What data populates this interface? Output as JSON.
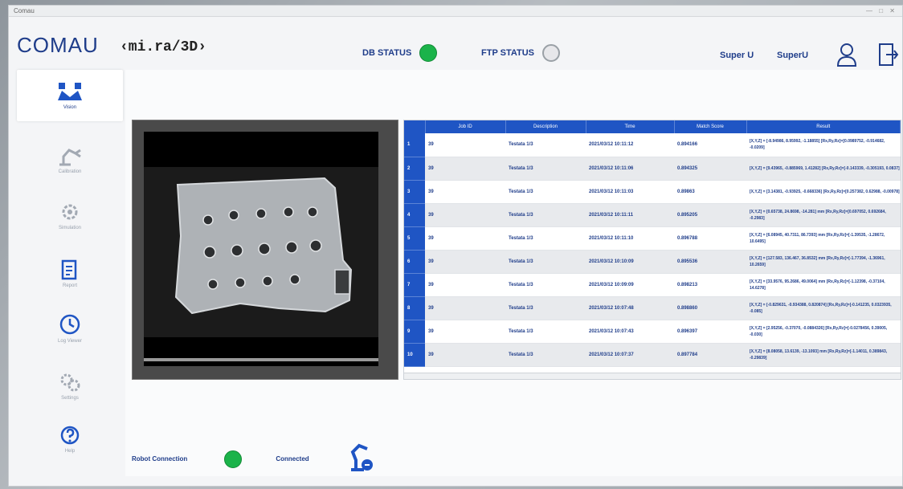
{
  "window": {
    "title": "Comau"
  },
  "header": {
    "logo": "COMAU",
    "product": "‹mi.ra/3D›",
    "db_status_label": "DB STATUS",
    "ftp_status_label": "FTP STATUS",
    "user_role": "Super U",
    "user_name": "SuperU"
  },
  "sidebar": {
    "items": [
      {
        "label": "Vision",
        "icon": "vision-icon"
      },
      {
        "label": "Calibration",
        "icon": "robot-arm-icon"
      },
      {
        "label": "Simulation",
        "icon": "gear-icon"
      },
      {
        "label": "Report",
        "icon": "report-icon"
      },
      {
        "label": "Log Viewer",
        "icon": "history-icon"
      },
      {
        "label": "Settings",
        "icon": "settings-icon"
      },
      {
        "label": "Help",
        "icon": "help-icon"
      }
    ]
  },
  "table": {
    "columns": [
      "Job ID",
      "Description",
      "Time",
      "Match Score",
      "Result"
    ],
    "rows": [
      {
        "n": "1",
        "job": "39",
        "desc": "Testata 1/3",
        "time": "2021/03/12 10:11:12",
        "score": "0.894166",
        "result": "[X,Y,Z] = [-8.94986, 8.95992, -1.18855] [Rx,Ry,Rz]=[0.0989752, -0.914682, -0.0209]"
      },
      {
        "n": "2",
        "job": "39",
        "desc": "Testata 1/3",
        "time": "2021/03/12 10:11:06",
        "score": "0.894325",
        "result": "[X,Y,Z] = [9.43965, -0.885969, 1.41282] [Rx,Ry,Rz]=[-0.143339, -0.305193, 0.0837]"
      },
      {
        "n": "3",
        "job": "39",
        "desc": "Testata 1/3",
        "time": "2021/03/12 10:11:03",
        "score": "0.89863",
        "result": "[X,Y,Z] = [3.14381, -0.93925, -0.668336] [Rx,Ry,Rz]=[0.257382, 0.62988, -0.00978]"
      },
      {
        "n": "4",
        "job": "39",
        "desc": "Testata 1/3",
        "time": "2021/03/12 10:11:11",
        "score": "0.895205",
        "result": "[X,Y,Z] = [0.65738, 24.8698, -14.281] mm [Rx,Ry,Rz]=[0.697052, 0.692684, -0.2983]"
      },
      {
        "n": "5",
        "job": "39",
        "desc": "Testata 1/3",
        "time": "2021/03/12 10:11:10",
        "score": "0.896788",
        "result": "[X,Y,Z] = [6.08945, 40.7311, 86.7393] mm [Rx,Ry,Rz]=[-1.39535, -1.28672, 10.6495]"
      },
      {
        "n": "6",
        "job": "39",
        "desc": "Testata 1/3",
        "time": "2021/03/12 10:10:09",
        "score": "0.895536",
        "result": "[X,Y,Z] = [127.583, 136.467, 36.8532] mm [Rx,Ry,Rz]=[-1.77394, -1.36961, 10.2659]"
      },
      {
        "n": "7",
        "job": "39",
        "desc": "Testata 1/3",
        "time": "2021/03/12 10:09:09",
        "score": "0.898213",
        "result": "[X,Y,Z] = [33.9576, 95.2686, 49.0064] mm [Rx,Ry,Rz]=[-1.12398, -0.37104, 14.6278]"
      },
      {
        "n": "8",
        "job": "39",
        "desc": "Testata 1/3",
        "time": "2021/03/12 10:07:48",
        "score": "0.898860",
        "result": "[X,Y,Z] = [-0.829631, -0.934388, 0.820874] [Rx,Ry,Rz]=[-0.141235, 0.0323935, -0.085]"
      },
      {
        "n": "9",
        "job": "39",
        "desc": "Testata 1/3",
        "time": "2021/03/12 10:07:43",
        "score": "0.896397",
        "result": "[X,Y,Z] = [2.95256, -0.37070, -0.0884326] [Rx,Ry,Rz]=[-0.0278456, 0.39005, -0.030]"
      },
      {
        "n": "10",
        "job": "39",
        "desc": "Testata 1/3",
        "time": "2021/03/12 10:07:37",
        "score": "0.897784",
        "result": "[X,Y,Z] = [8.08058, 13.6139, -13.1093] mm [Rx,Ry,Rz]=[-1.14011, 0.389843, -0.29839]"
      }
    ]
  },
  "robot": {
    "label": "Robot Connection",
    "state": "Connected"
  },
  "colors": {
    "accent": "#1f55c4",
    "brand": "#1f3d8a",
    "ok": "#1bb34a"
  }
}
